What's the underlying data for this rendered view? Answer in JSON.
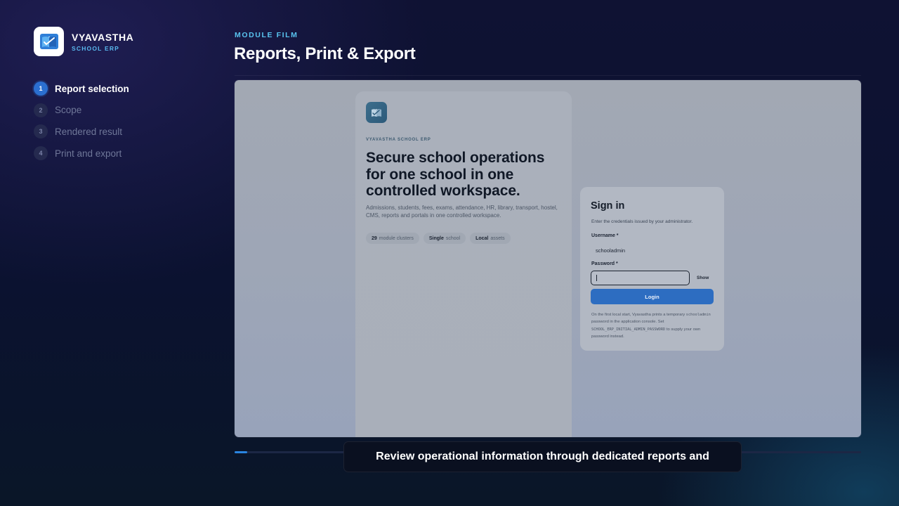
{
  "brand": {
    "name": "VYAVASTHA",
    "subtitle": "SCHOOL ERP",
    "icon": "open-book-icon"
  },
  "steps": [
    {
      "num": "1",
      "label": "Report selection",
      "active": true
    },
    {
      "num": "2",
      "label": "Scope",
      "active": false
    },
    {
      "num": "3",
      "label": "Rendered result",
      "active": false
    },
    {
      "num": "4",
      "label": "Print and export",
      "active": false
    }
  ],
  "header": {
    "eyebrow": "MODULE FILM",
    "title": "Reports, Print & Export"
  },
  "screen": {
    "hero": {
      "eyebrow": "VYAVASTHA SCHOOL ERP",
      "headline": "Secure school operations for one school in one controlled workspace.",
      "description": "Admissions, students, fees, exams, attendance, HR, library, transport, hostel, CMS, reports and portals in one controlled workspace.",
      "chips": [
        {
          "strong": "29",
          "text": "module clusters"
        },
        {
          "strong": "Single",
          "text": "school"
        },
        {
          "strong": "Local",
          "text": "assets"
        }
      ]
    },
    "signin": {
      "title": "Sign in",
      "subtitle": "Enter the credentials issued by your administrator.",
      "username_label": "Username *",
      "username_value": "schooladmin",
      "password_label": "Password *",
      "password_value": "",
      "show_label": "Show",
      "login_label": "Login",
      "note_part1": "On the first local start, Vyavastha prints a temporary",
      "note_code1": "schooladmin",
      "note_part2": "password in the application console. Set",
      "note_code2": "SCHOOL_ERP_INITIAL_ADMIN_PASSWORD",
      "note_part3": "to supply your own password instead."
    }
  },
  "progress": {
    "fraction": 0.02
  },
  "caption": {
    "text": "Review operational information through dedicated reports and"
  },
  "colors": {
    "accent": "#2b6fd0",
    "eyebrow": "#59c4f0",
    "background": "#0f1233"
  }
}
